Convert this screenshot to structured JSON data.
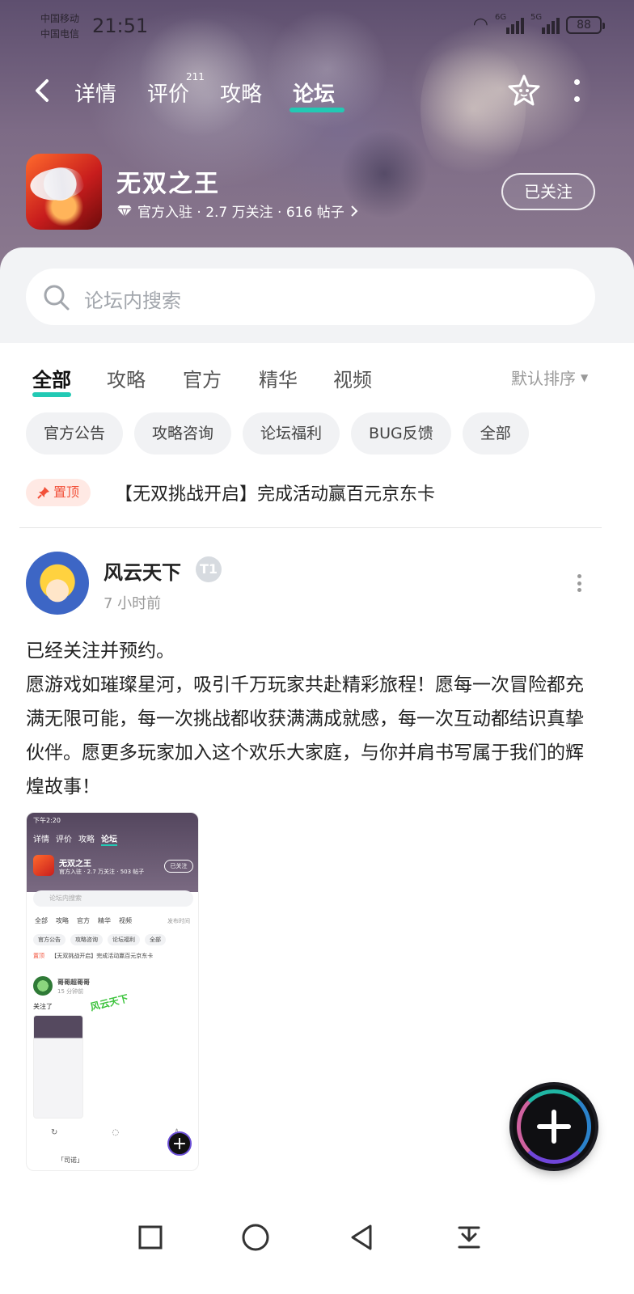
{
  "status_bar": {
    "carrier1": "中国移动",
    "carrier2": "中国电信",
    "time": "21:51",
    "net1": "6G",
    "net2": "5G",
    "battery": "88"
  },
  "nav": {
    "tabs": [
      "详情",
      "评价",
      "攻略",
      "论坛"
    ],
    "active_tab": "论坛",
    "review_count": "211"
  },
  "game": {
    "name": "无双之王",
    "meta": "官方入驻 · 2.7 万关注 · 616 帖子",
    "follow_label": "已关注"
  },
  "search": {
    "placeholder": "论坛内搜索"
  },
  "filters": {
    "tabs": [
      "全部",
      "攻略",
      "官方",
      "精华",
      "视频"
    ],
    "sort_label": "默认排序",
    "chips": [
      "官方公告",
      "攻略咨询",
      "论坛福利",
      "BUG反馈",
      "全部"
    ]
  },
  "pinned": {
    "badge": "置顶",
    "title": "【无双挑战开启】完成活动赢百元京东卡"
  },
  "post": {
    "author": "风云天下",
    "level": "T1",
    "time": "7 小时前",
    "lines": [
      "已经关注并预约。",
      "愿游戏如璀璨星河，吸引千万玩家共赴精彩旅程！愿每一次冒险都充满无限可能，每一次挑战都收获满满成就感，每一次互动都结识真挚伙伴。愿更多玩家加入这个欢乐大家庭，与你并肩书写属于我们的辉煌故事！"
    ]
  },
  "screenshot": {
    "time": "下午2:20",
    "tabs": [
      "详情",
      "评价",
      "攻略",
      "论坛"
    ],
    "game_name": "无双之王",
    "meta": "官方入驻 · 2.7 万关注 · 503 帖子",
    "follow": "已关注",
    "search": "论坛内搜索",
    "ftabs": [
      "全部",
      "攻略",
      "官方",
      "精华",
      "视频"
    ],
    "sort": "发布时间",
    "chips": [
      "官方公告",
      "攻略咨询",
      "论坛福利",
      "全部"
    ],
    "pin_tag": "置顶",
    "pin_title": "【无双挑战开启】完成活动赢百元京东卡",
    "user": "哥哥超哥哥",
    "ago": "15 分钟前",
    "text": "关注了",
    "watermark": "风云天下",
    "user2": "「司诺」",
    "nav": "≡  □  <"
  },
  "colors": {
    "accent": "#22c9b4",
    "pin": "#f2513a"
  }
}
